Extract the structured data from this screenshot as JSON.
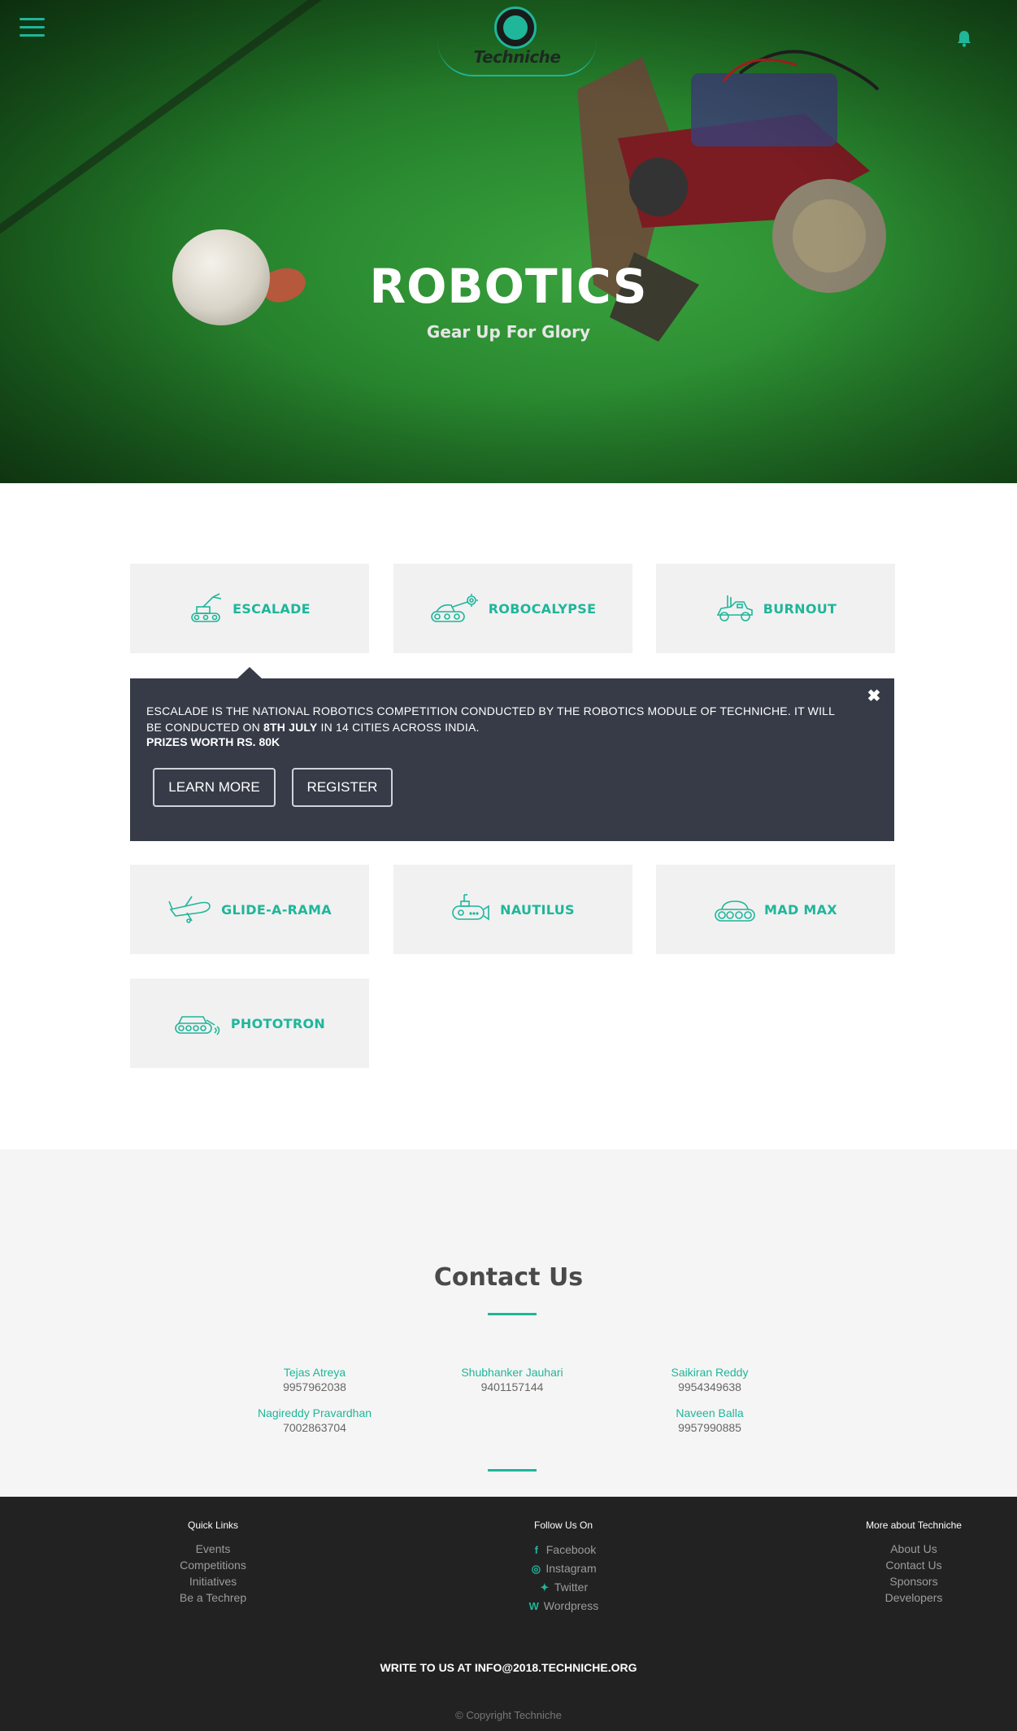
{
  "header": {
    "menu_icon": "hamburger-menu-icon",
    "bell_icon": "bell-icon",
    "logo_text": "Techniche",
    "accent_color": "#1fb69a"
  },
  "hero": {
    "title": "ROBOTICS",
    "subtitle": "Gear Up For Glory"
  },
  "competitions": [
    {
      "label": "ESCALADE",
      "icon": "robot-arm-tank-icon"
    },
    {
      "label": "ROBOCALYPSE",
      "icon": "gear-arm-robot-icon"
    },
    {
      "label": "BURNOUT",
      "icon": "race-car-icon"
    },
    {
      "label": "GLIDE-A-RAMA",
      "icon": "airplane-icon"
    },
    {
      "label": "NAUTILUS",
      "icon": "submarine-icon"
    },
    {
      "label": "MAD MAX",
      "icon": "tracked-tank-icon"
    },
    {
      "label": "PHOTOTRON",
      "icon": "sensor-tank-icon"
    }
  ],
  "popup": {
    "desc_part1": "Escalade is the national robotics competition conducted by the robotics module of Techniche. It will be conducted on ",
    "desc_bold": "8th July",
    "desc_part2": " in 14 cities across India.",
    "prize": "Prizes worth Rs. 80k",
    "close": "✖",
    "learn_more": "LEARN MORE",
    "register": "REGISTER"
  },
  "contact": {
    "title": "Contact Us",
    "people": [
      {
        "name": "Tejas Atreya",
        "phone": "9957962038"
      },
      {
        "name": "Shubhanker Jauhari",
        "phone": "9401157144"
      },
      {
        "name": "Saikiran Reddy",
        "phone": "9954349638"
      },
      {
        "name": "Nagireddy Pravardhan",
        "phone": "7002863704"
      },
      {
        "name": "Naveen Balla",
        "phone": "9957990885"
      }
    ]
  },
  "footer": {
    "quick_links": {
      "title": "Quick Links",
      "items": [
        "Events",
        "Competitions",
        "Initiatives",
        "Be a Techrep"
      ]
    },
    "follow": {
      "title": "Follow Us On",
      "items": [
        {
          "label": "Facebook",
          "glyph": "f"
        },
        {
          "label": "Instagram",
          "glyph": "◎"
        },
        {
          "label": "Twitter",
          "glyph": "✦"
        },
        {
          "label": "Wordpress",
          "glyph": "W"
        }
      ]
    },
    "more": {
      "title": "More about Techniche",
      "items": [
        "About Us",
        "Contact Us",
        "Sponsors",
        "Developers"
      ]
    },
    "write": "Write to us at info@2018.techniche.org",
    "copyright": "© Copyright Techniche"
  }
}
